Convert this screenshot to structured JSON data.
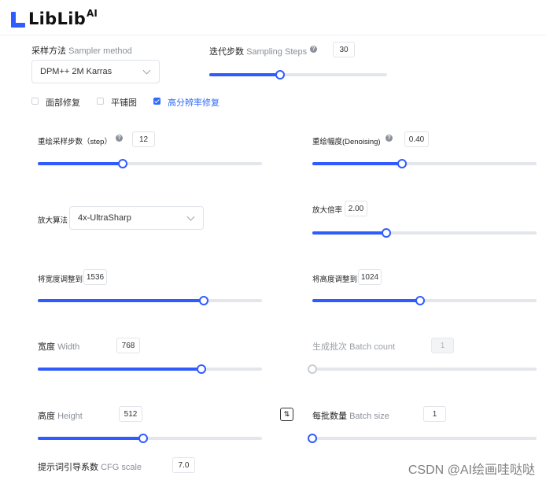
{
  "logo": {
    "text": "LibLib",
    "sup": "AI"
  },
  "sampler": {
    "label": "采样方法",
    "label_en": "Sampler method",
    "value": "DPM++ 2M Karras"
  },
  "steps": {
    "label": "迭代步数",
    "label_en": "Sampling Steps",
    "value": "30",
    "help": "?",
    "level": 0.4
  },
  "options": [
    {
      "label": "面部修复",
      "checked": false
    },
    {
      "label": "平铺图",
      "checked": false
    },
    {
      "label": "高分辨率修复",
      "checked": true
    }
  ],
  "hires": {
    "steps": {
      "label": "重绘采样步数（step）",
      "value": "12",
      "help": "?",
      "level": 0.38
    },
    "denoising": {
      "label": "重绘幅度(Denoising)",
      "value": "0.40",
      "help": "?",
      "level": 0.4
    },
    "upscaler": {
      "label": "放大算法",
      "value": "4x-UltraSharp"
    },
    "scale": {
      "label": "放大倍率",
      "value": "2.00",
      "level": 0.33
    },
    "resize_width": {
      "label": "将宽度调整到",
      "value": "1536",
      "level": 0.74
    },
    "resize_height": {
      "label": "将高度调整到",
      "value": "1024",
      "level": 0.48
    }
  },
  "width": {
    "label": "宽度",
    "label_en": "Width",
    "value": "768",
    "level": 0.73
  },
  "batch_count": {
    "label": "生成批次",
    "label_en": "Batch count",
    "value": "1",
    "level": 0.0
  },
  "height": {
    "label": "高度",
    "label_en": "Height",
    "value": "512",
    "level": 0.47
  },
  "batch_size": {
    "label": "每批数量",
    "label_en": "Batch size",
    "value": "1",
    "level": 0.0
  },
  "cfg": {
    "label": "提示词引导系数",
    "label_en": "CFG scale",
    "value": "7.0"
  },
  "swap_icon": "swap-icon",
  "watermark": "CSDN @AI绘画哇哒哒",
  "colors": {
    "accent": "#2f5bff",
    "track": "#e3e6eb",
    "checked_text": "#2f6bff"
  }
}
